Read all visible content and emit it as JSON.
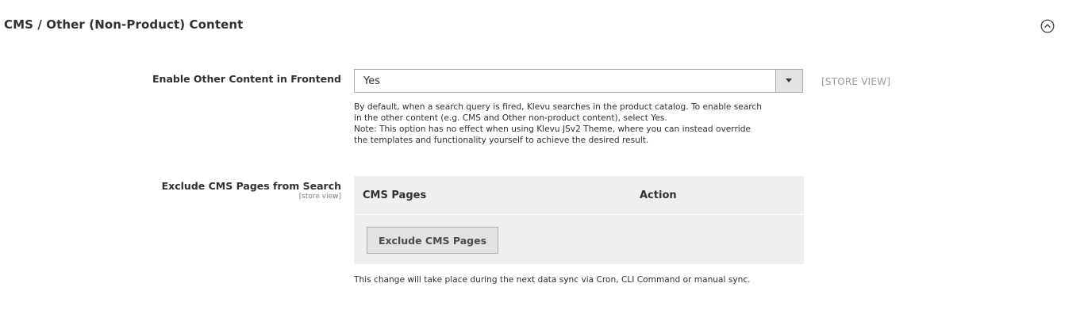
{
  "section": {
    "title": "CMS / Other (Non-Product) Content"
  },
  "enable_other_content": {
    "label": "Enable Other Content in Frontend",
    "selected_value": "Yes",
    "scope": "[STORE VIEW]",
    "note_lines": [
      "By default, when a search query is fired, Klevu searches in the product catalog. To enable search",
      "in the other content (e.g. CMS and Other non-product content), select Yes.",
      "Note: This option has no effect when using Klevu JSv2 Theme, where you can instead override",
      "the templates and functionality yourself to achieve the desired result."
    ]
  },
  "exclude_cms": {
    "label": "Exclude CMS Pages from Search",
    "scope": "[store view]",
    "columns": {
      "cms_pages": "CMS Pages",
      "action": "Action"
    },
    "button_label": "Exclude CMS Pages",
    "note": "This change will take place during the next data sync via Cron, CLI Command or manual sync."
  },
  "icons": {
    "collapse": "chevron-up-circle-icon",
    "select_arrow": "caret-down-icon"
  },
  "colors": {
    "text": "#303030",
    "muted": "#9a9a9a",
    "grid_bg": "#efefef",
    "button_bg": "#e3e3e3",
    "border": "#adadad"
  }
}
